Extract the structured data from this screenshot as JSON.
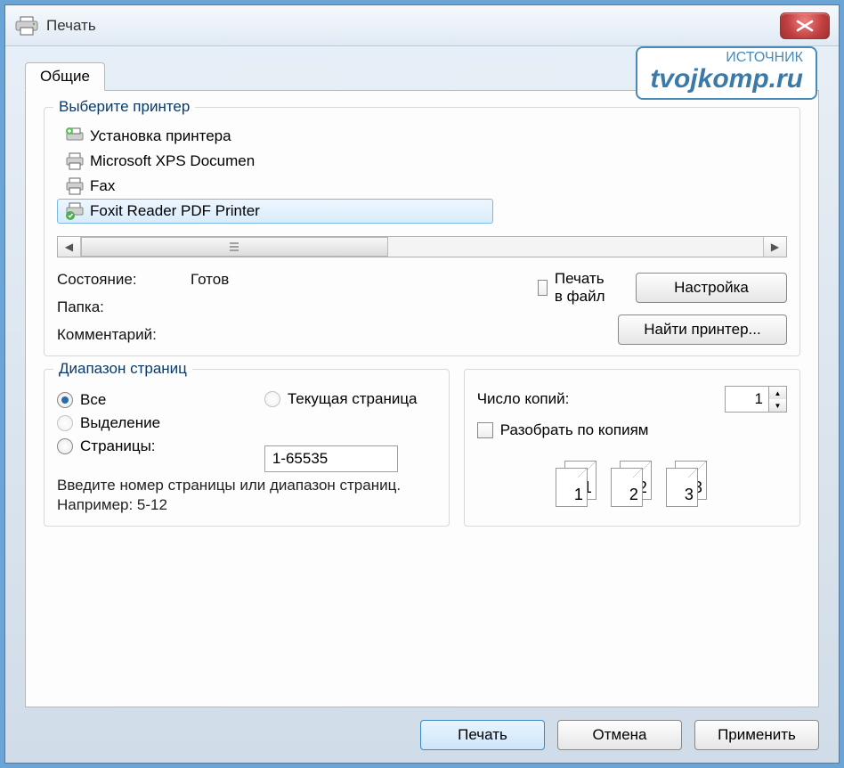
{
  "window": {
    "title": "Печать"
  },
  "watermark": {
    "label": "ИСТОЧНИК",
    "url": "tvojkomp.ru"
  },
  "tabs": {
    "general": "Общие"
  },
  "printerGroup": {
    "legend": "Выберите принтер",
    "items": {
      "add": "Установка принтера",
      "fax": "Fax",
      "foxit": "Foxit Reader PDF Printer",
      "xps": "Microsoft XPS Documen"
    },
    "status": {
      "state_label": "Состояние:",
      "state_value": "Готов",
      "folder_label": "Папка:",
      "comment_label": "Комментарий:"
    },
    "printToFile": "Печать в файл",
    "settingsBtn": "Настройка",
    "findPrinterBtn": "Найти принтер..."
  },
  "rangeGroup": {
    "legend": "Диапазон страниц",
    "all": "Все",
    "current": "Текущая страница",
    "selection": "Выделение",
    "pagesLabel": "Страницы:",
    "pagesValue": "1-65535",
    "hint": "Введите номер страницы или диапазон страниц.  Например: 5-12"
  },
  "copiesGroup": {
    "countLabel": "Число копий:",
    "countValue": "1",
    "collate": "Разобрать по копиям",
    "preview": {
      "one": "1",
      "two": "2",
      "three": "3"
    }
  },
  "buttons": {
    "print": "Печать",
    "cancel": "Отмена",
    "apply": "Применить"
  }
}
